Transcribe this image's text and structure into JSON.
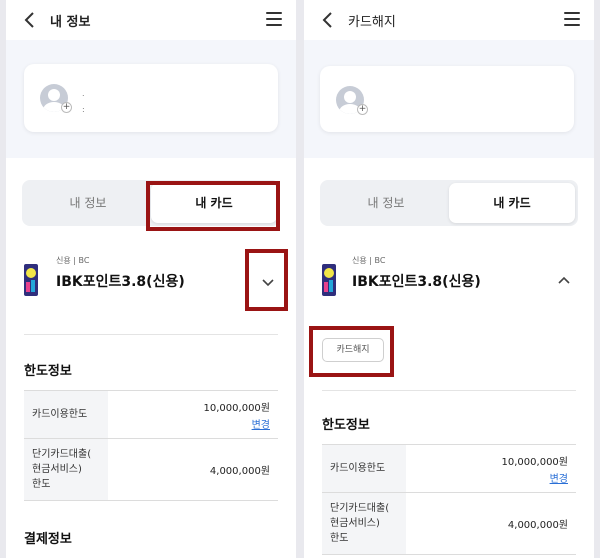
{
  "left": {
    "header_title": "내 정보",
    "profile_dots": ".",
    "profile_dots2": ":",
    "tabs": [
      {
        "label": "내 정보"
      },
      {
        "label": "내 카드"
      }
    ],
    "card": {
      "type": "신용 | BC",
      "name": "IBK포인트3.8(신용)"
    },
    "limit_section": "한도정보",
    "rows": [
      {
        "key": "카드이용한도",
        "value": "10,000,000원",
        "action": "변경"
      },
      {
        "key": "단기카드대출(\n현금서비스)\n한도",
        "value": "4,000,000원"
      }
    ],
    "payment_section": "결제정보"
  },
  "right": {
    "header_title": "카드해지",
    "tabs": [
      {
        "label": "내 정보"
      },
      {
        "label": "내 카드"
      }
    ],
    "card": {
      "type": "신용 | BC",
      "name": "IBK포인트3.8(신용)"
    },
    "cancel_button": "카드해지",
    "limit_section": "한도정보",
    "rows": [
      {
        "key": "카드이용한도",
        "value": "10,000,000원",
        "action": "변경"
      },
      {
        "key": "단기카드대출(\n현금서비스)\n한도",
        "value": "4,000,000원"
      }
    ]
  },
  "icons": [
    "back-arrow-icon",
    "hamburger-menu-icon",
    "avatar-icon",
    "add-photo-icon",
    "chevron-down-icon",
    "chevron-up-icon",
    "card-thumbnail-icon"
  ],
  "colors": {
    "highlight": "#9a1414",
    "link": "#2a6fd6",
    "page_bg": "#f4f6fb"
  }
}
